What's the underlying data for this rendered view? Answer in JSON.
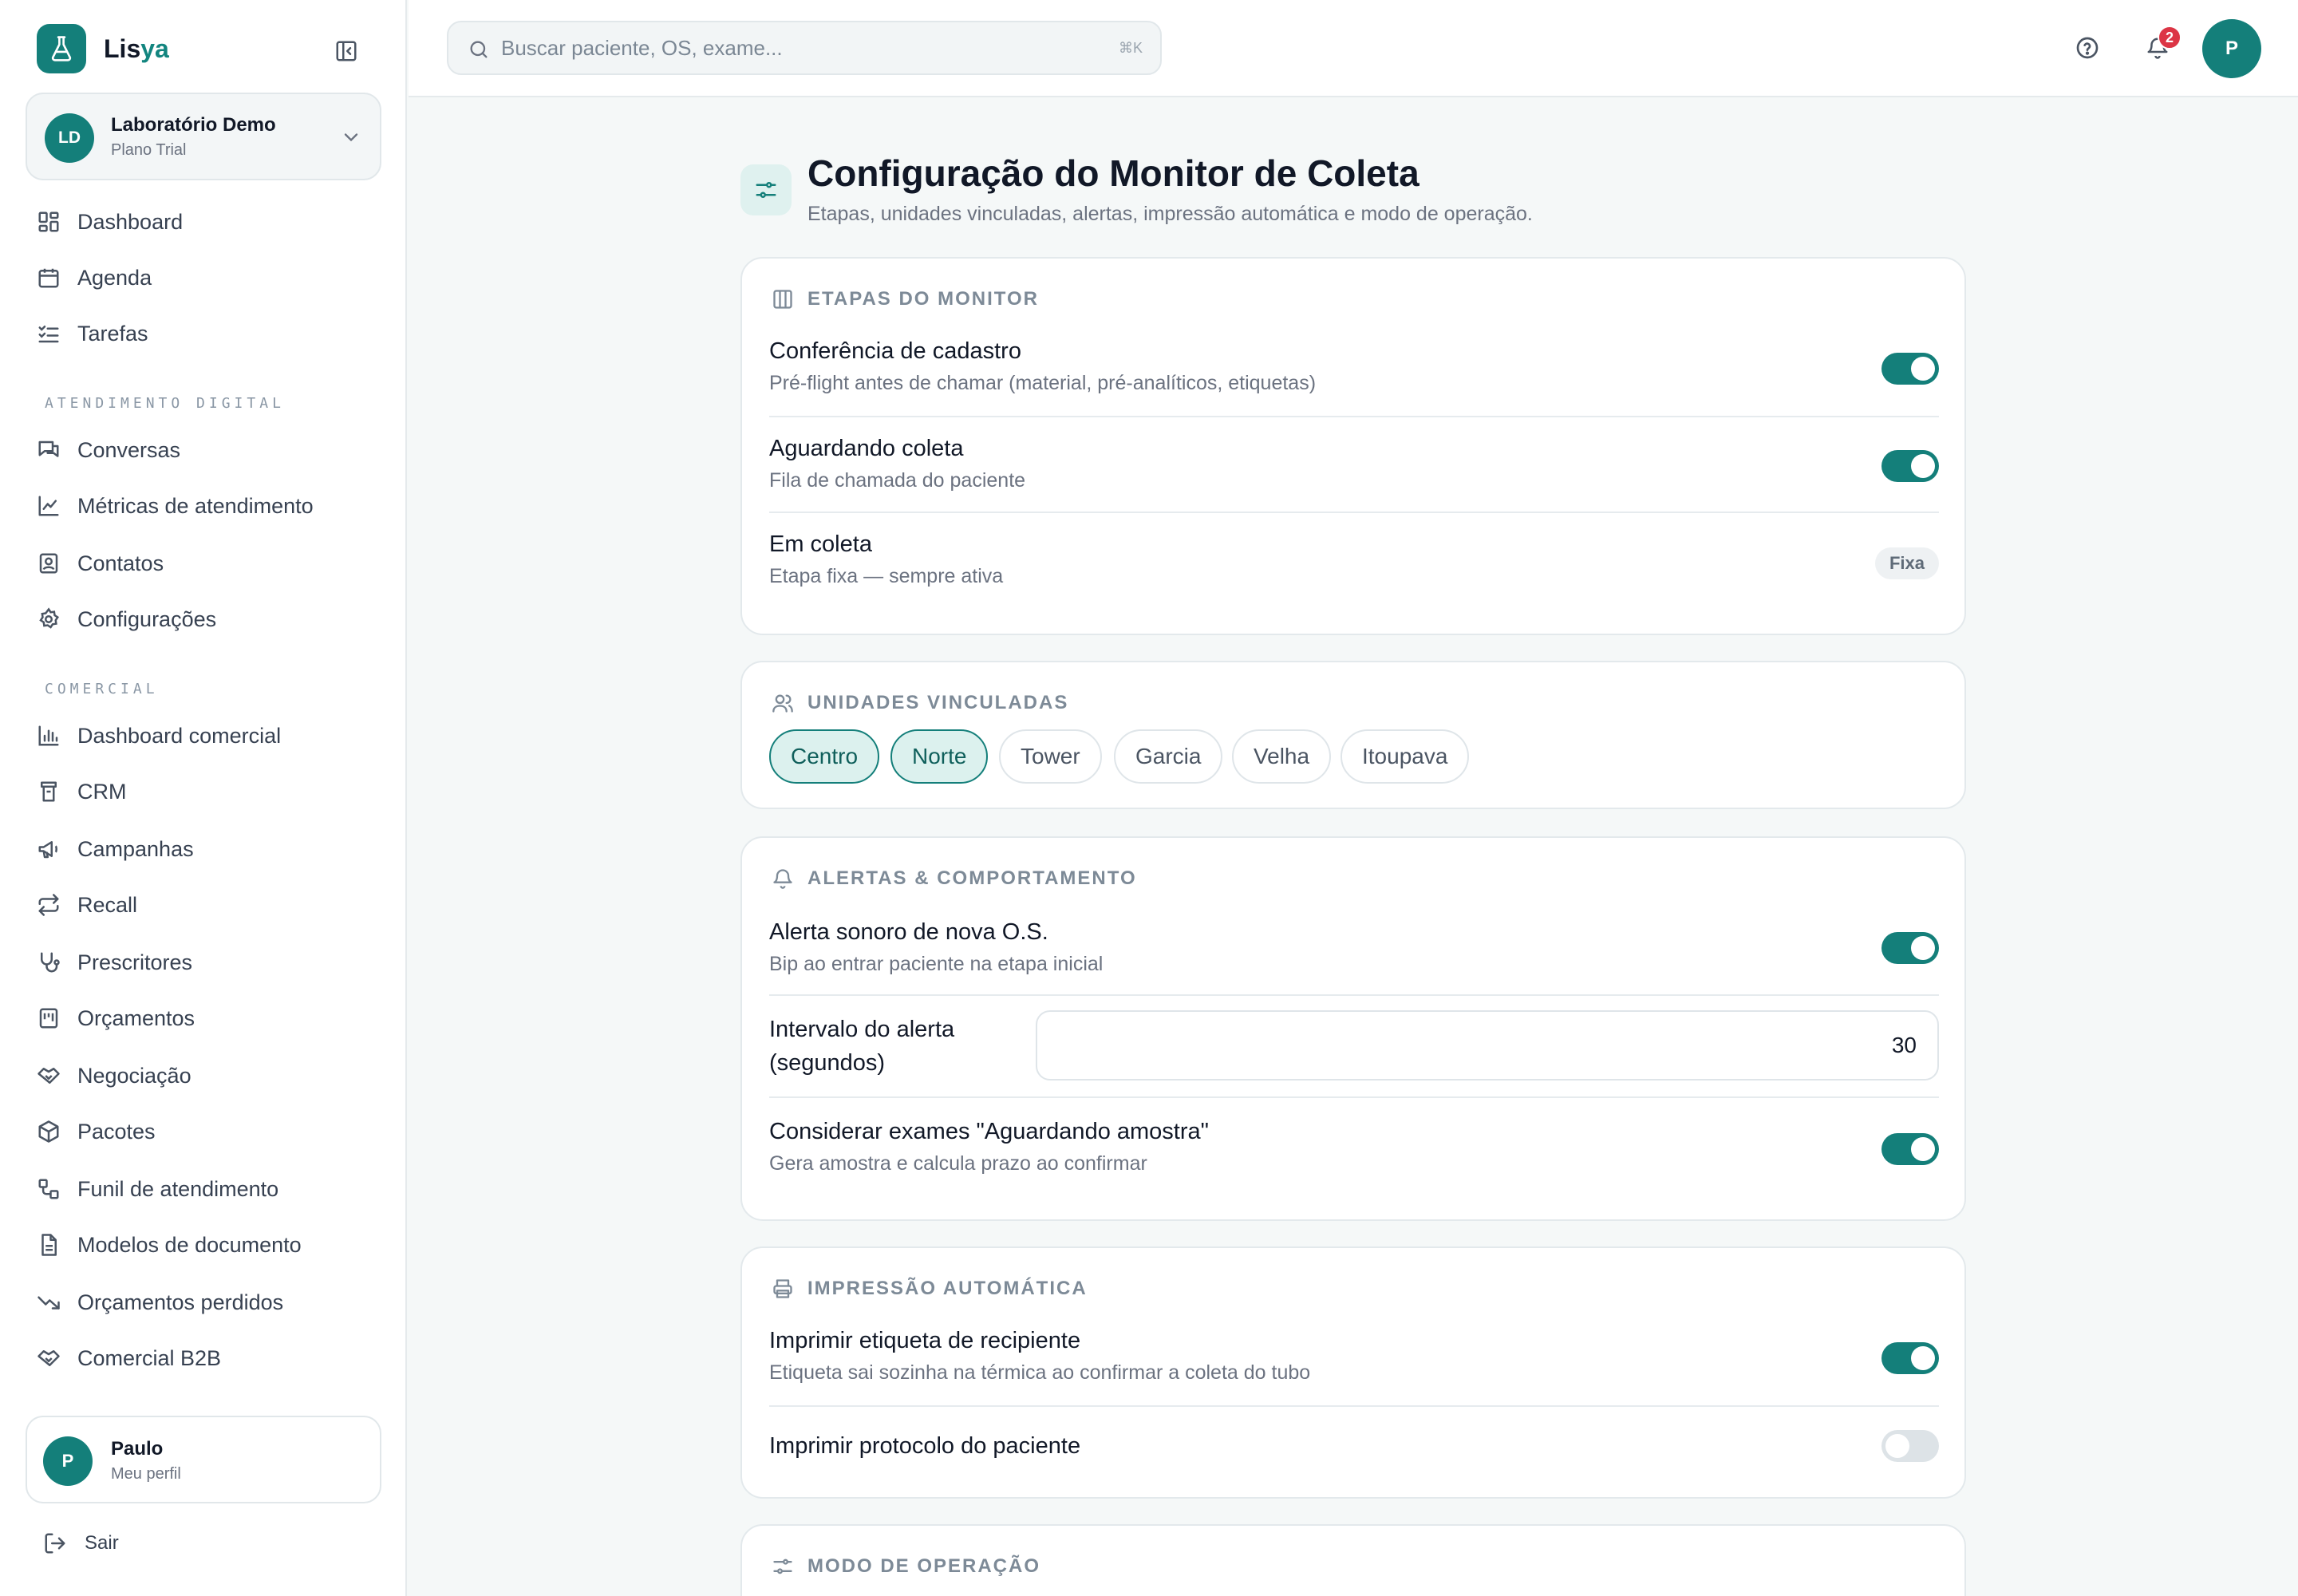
{
  "brand": {
    "name_main": "Lis",
    "name_accent": "ya"
  },
  "org": {
    "initials": "LD",
    "name": "Laboratório Demo",
    "plan": "Plano Trial"
  },
  "sidebar": {
    "main_items": [
      {
        "label": "Dashboard",
        "icon": "dashboard-icon"
      },
      {
        "label": "Agenda",
        "icon": "calendar-icon"
      },
      {
        "label": "Tarefas",
        "icon": "tasks-icon"
      }
    ],
    "section_digital": "ATENDIMENTO DIGITAL",
    "digital_items": [
      {
        "label": "Conversas",
        "icon": "chat-icon"
      },
      {
        "label": "Métricas de atendimento",
        "icon": "line-chart-icon"
      },
      {
        "label": "Contatos",
        "icon": "contacts-icon"
      },
      {
        "label": "Configurações",
        "icon": "gear-icon"
      }
    ],
    "section_comercial": "COMERCIAL",
    "comercial_items": [
      {
        "label": "Dashboard comercial",
        "icon": "bar-chart-icon"
      },
      {
        "label": "CRM",
        "icon": "crm-icon"
      },
      {
        "label": "Campanhas",
        "icon": "megaphone-icon"
      },
      {
        "label": "Recall",
        "icon": "repeat-icon"
      },
      {
        "label": "Prescritores",
        "icon": "stethoscope-icon"
      },
      {
        "label": "Orçamentos",
        "icon": "budget-icon"
      },
      {
        "label": "Negociação",
        "icon": "handshake-icon"
      },
      {
        "label": "Pacotes",
        "icon": "package-icon"
      },
      {
        "label": "Funil de atendimento",
        "icon": "funnel-icon"
      },
      {
        "label": "Modelos de documento",
        "icon": "document-icon"
      },
      {
        "label": "Orçamentos perdidos",
        "icon": "trending-down-icon"
      },
      {
        "label": "Comercial B2B",
        "icon": "handshake-icon"
      }
    ]
  },
  "profile": {
    "initial": "P",
    "name": "Paulo",
    "sub": "Meu perfil"
  },
  "logout_label": "Sair",
  "topbar": {
    "search_placeholder": "Buscar paciente, OS, exame...",
    "search_shortcut": "⌘K",
    "notifications_count": "2",
    "user_initial": "P"
  },
  "page": {
    "title": "Configuração do Monitor de Coleta",
    "subtitle": "Etapas, unidades vinculadas, alertas, impressão automática e modo de operação."
  },
  "etapas": {
    "header": "ETAPAS DO MONITOR",
    "rows": [
      {
        "title": "Conferência de cadastro",
        "desc": "Pré-flight antes de chamar (material, pré-analíticos, etiquetas)",
        "enabled": true
      },
      {
        "title": "Aguardando coleta",
        "desc": "Fila de chamada do paciente",
        "enabled": true
      },
      {
        "title": "Em coleta",
        "desc": "Etapa fixa — sempre ativa",
        "badge": "Fixa"
      }
    ]
  },
  "unidades": {
    "header": "UNIDADES VINCULADAS",
    "chips": [
      {
        "label": "Centro",
        "active": true
      },
      {
        "label": "Norte",
        "active": true
      },
      {
        "label": "Tower",
        "active": false
      },
      {
        "label": "Garcia",
        "active": false
      },
      {
        "label": "Velha",
        "active": false
      },
      {
        "label": "Itoupava",
        "active": false
      }
    ]
  },
  "alertas": {
    "header": "ALERTAS & COMPORTAMENTO",
    "sound_title": "Alerta sonoro de nova O.S.",
    "sound_desc": "Bip ao entrar paciente na etapa inicial",
    "sound_enabled": true,
    "interval_label_1": "Intervalo do alerta",
    "interval_label_2": "(segundos)",
    "interval_value": "30",
    "consider_title": "Considerar exames \"Aguardando amostra\"",
    "consider_desc": "Gera amostra e calcula prazo ao confirmar",
    "consider_enabled": true
  },
  "impressao": {
    "header": "IMPRESSÃO AUTOMÁTICA",
    "label_title": "Imprimir etiqueta de recipiente",
    "label_desc": "Etiqueta sai sozinha na térmica ao confirmar a coleta do tubo",
    "label_enabled": true,
    "protocol_title": "Imprimir protocolo do paciente",
    "protocol_enabled": false
  },
  "modo": {
    "header": "MODO DE OPERAÇÃO"
  },
  "colors": {
    "primary": "#147f7a",
    "accent": "#12857f",
    "badge": "#dc3545"
  }
}
